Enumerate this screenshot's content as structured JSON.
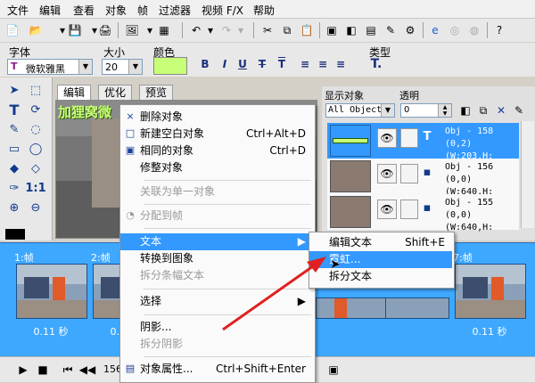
{
  "menubar": {
    "items": [
      "文件",
      "编辑",
      "查看",
      "对象",
      "帧",
      "过滤器",
      "视频 F/X",
      "帮助"
    ]
  },
  "toolbar2": {
    "font_label": "字体",
    "size_label": "大小",
    "color_label": "颜色",
    "type_label": "类型",
    "font_value": "微软雅黑",
    "size_value": "20",
    "color_swatch": "#c8ff78",
    "format_buttons": [
      "B",
      "I",
      "U",
      "T",
      "T"
    ],
    "type_icon": "T."
  },
  "tabs": [
    "编辑",
    "优化",
    "预览"
  ],
  "canvas": {
    "overlay_text": "加狸窝微"
  },
  "right_panel": {
    "display_objects_label": "显示对象",
    "transparency_label": "透明",
    "filter_value": "All Object:",
    "transparency_value": "0"
  },
  "objects": [
    {
      "name": "Obj - 158",
      "info": "(0,2)(W:203,H:"
    },
    {
      "name": "Obj - 156",
      "info": "(0,0)(W:640,H:"
    },
    {
      "name": "Obj - 155",
      "info": "(0,0)(W:640,H:"
    }
  ],
  "frames": [
    {
      "label": "1:帧",
      "time": "0.11 秒"
    },
    {
      "label": "2:帧",
      "time": "0.11 秒"
    },
    {
      "label": "7:帧",
      "time": "0.11 秒"
    }
  ],
  "bottombar": {
    "frame_counter": "156"
  },
  "context_menu": {
    "items": [
      {
        "label": "删除对象",
        "shortcut": "",
        "icon": "×"
      },
      {
        "label": "新建空白对象",
        "shortcut": "Ctrl+Alt+D",
        "icon": "□"
      },
      {
        "label": "相同的对象",
        "shortcut": "Ctrl+D",
        "icon": "▣"
      },
      {
        "label": "修整对象",
        "shortcut": "",
        "icon": ""
      },
      {
        "label": "关联为单一对象",
        "shortcut": "",
        "icon": ""
      },
      {
        "label": "分配到帧",
        "shortcut": "",
        "icon": "◔"
      },
      {
        "label": "文本",
        "shortcut": "",
        "icon": ""
      },
      {
        "label": "转换到图象",
        "shortcut": "",
        "icon": ""
      },
      {
        "label": "拆分条幅文本",
        "shortcut": "",
        "icon": ""
      },
      {
        "label": "选择",
        "shortcut": "",
        "icon": ""
      },
      {
        "label": "阴影...",
        "shortcut": "",
        "icon": ""
      },
      {
        "label": "拆分阴影",
        "shortcut": "",
        "icon": ""
      },
      {
        "label": "对象属性...",
        "shortcut": "Ctrl+Shift+Enter",
        "icon": "▤"
      }
    ]
  },
  "submenu": {
    "items": [
      {
        "label": "编辑文本",
        "shortcut": "Shift+E"
      },
      {
        "label": "霓虹...",
        "shortcut": ""
      },
      {
        "label": "拆分文本",
        "shortcut": ""
      }
    ]
  },
  "colors": {
    "accent": "#3399ff",
    "arrow": "#e02020",
    "timeline": "#3ea8ff"
  }
}
